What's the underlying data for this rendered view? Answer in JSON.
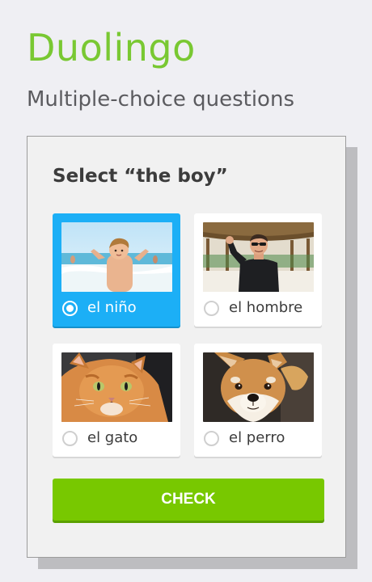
{
  "header": {
    "brand": "Duolingo",
    "subtitle": "Multiple-choice questions"
  },
  "exercise": {
    "prompt": "Select “the boy”",
    "options": [
      {
        "label": "el niño",
        "image": "boy-photo",
        "selected": true
      },
      {
        "label": "el hombre",
        "image": "man-photo",
        "selected": false
      },
      {
        "label": "el gato",
        "image": "cat-photo",
        "selected": false
      },
      {
        "label": "el perro",
        "image": "dog-photo",
        "selected": false
      }
    ],
    "check_label": "CHECK"
  },
  "colors": {
    "brand_green": "#79c832",
    "selected_blue": "#1caff6",
    "check_green": "#78c800"
  }
}
